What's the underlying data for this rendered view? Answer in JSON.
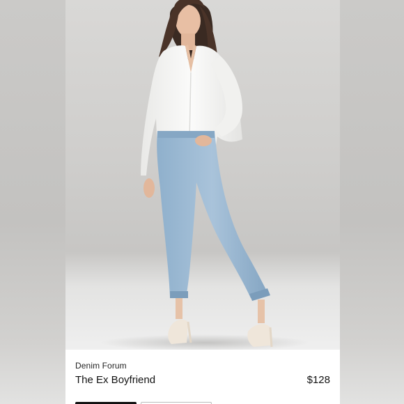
{
  "listing": {
    "brand": "Denim Forum",
    "title": "The Ex Boyfriend",
    "price": "$128"
  },
  "photo": {
    "subject": "model-photo"
  },
  "colors": {
    "background": "#cfcecc",
    "card": "#ffffff",
    "primary_button": "#111111",
    "denim": "#9bb7d0",
    "shirt": "#f6f6f4"
  }
}
